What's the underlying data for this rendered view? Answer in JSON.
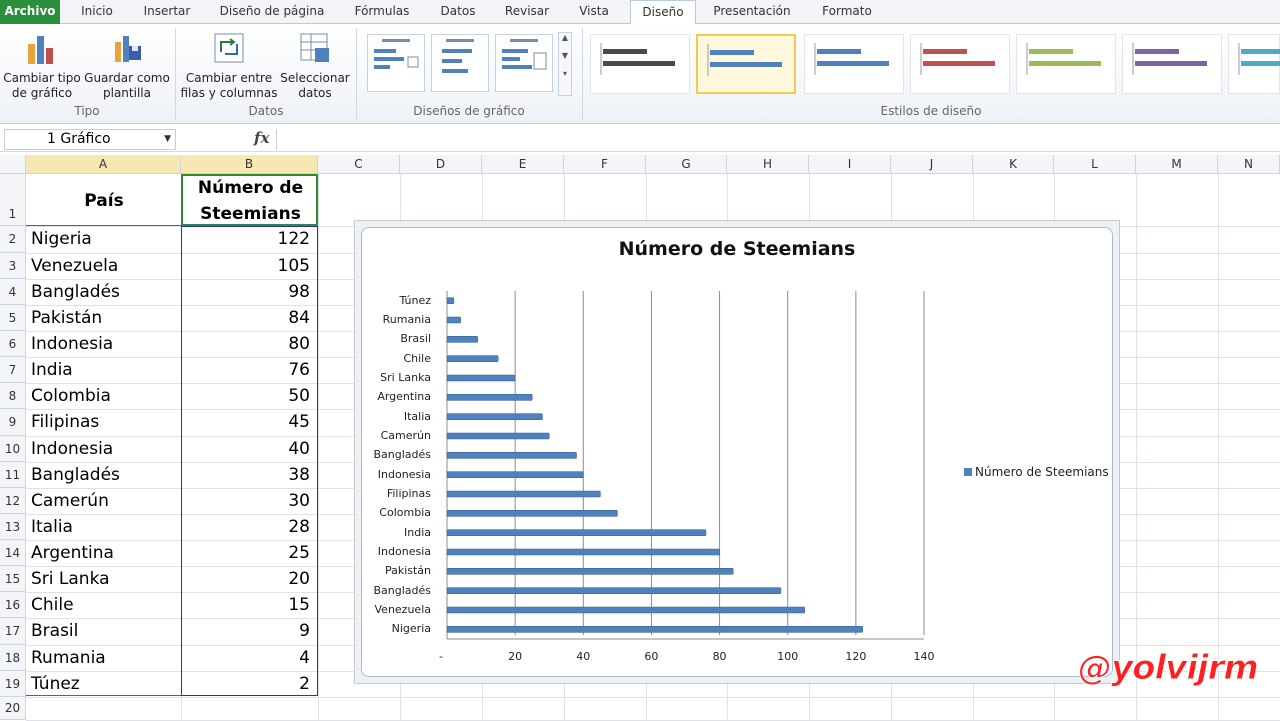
{
  "tabs": [
    {
      "label": "Archivo"
    },
    {
      "label": "Inicio"
    },
    {
      "label": "Insertar"
    },
    {
      "label": "Diseño de página"
    },
    {
      "label": "Fórmulas"
    },
    {
      "label": "Datos"
    },
    {
      "label": "Revisar"
    },
    {
      "label": "Vista"
    },
    {
      "label": "Diseño"
    },
    {
      "label": "Presentación"
    },
    {
      "label": "Formato"
    }
  ],
  "ribbon": {
    "cambiar_tipo": "Cambiar tipo de gráfico",
    "guardar_plantilla": "Guardar como plantilla",
    "cambiar_filas": "Cambiar entre filas y columnas",
    "seleccionar_datos": "Seleccionar datos",
    "group_tipo": "Tipo",
    "group_datos": "Datos",
    "group_disenos": "Diseños de gráfico",
    "group_estilos": "Estilos de diseño",
    "style_colors": [
      "#4a4a4a",
      "#4f81bd",
      "#4f81bd",
      "#c0504d",
      "#9bbb59",
      "#8064a2",
      "#4bacc6"
    ]
  },
  "namebox": {
    "value": "1 Gráfico"
  },
  "formula_icon": "fx",
  "columns": [
    "A",
    "B",
    "C",
    "D",
    "E",
    "F",
    "G",
    "H",
    "I",
    "J",
    "K",
    "L",
    "M",
    "N"
  ],
  "rows": [
    "1",
    "2",
    "3",
    "4",
    "5",
    "6",
    "7",
    "8",
    "9",
    "10",
    "11",
    "12",
    "13",
    "14",
    "15",
    "16",
    "17",
    "18",
    "19",
    "20"
  ],
  "table": {
    "header_pais": "País",
    "header_num_1": "Número de",
    "header_num_2": "Steemians",
    "rows": [
      {
        "pais": "Nigeria",
        "n": "122"
      },
      {
        "pais": "Venezuela",
        "n": "105"
      },
      {
        "pais": "Bangladés",
        "n": "98"
      },
      {
        "pais": "Pakistán",
        "n": "84"
      },
      {
        "pais": "Indonesia",
        "n": "80"
      },
      {
        "pais": "India",
        "n": "76"
      },
      {
        "pais": "Colombia",
        "n": "50"
      },
      {
        "pais": "Filipinas",
        "n": "45"
      },
      {
        "pais": "Indonesia",
        "n": "40"
      },
      {
        "pais": "Bangladés",
        "n": "38"
      },
      {
        "pais": "Camerún",
        "n": "30"
      },
      {
        "pais": "Italia",
        "n": "28"
      },
      {
        "pais": "Argentina",
        "n": "25"
      },
      {
        "pais": "Sri Lanka",
        "n": "20"
      },
      {
        "pais": "Chile",
        "n": "15"
      },
      {
        "pais": "Brasil",
        "n": "9"
      },
      {
        "pais": "Rumania",
        "n": "4"
      },
      {
        "pais": "Túnez",
        "n": "2"
      }
    ]
  },
  "chart_data": {
    "type": "bar",
    "orientation": "horizontal",
    "title": "Número de Steemians",
    "categories": [
      "Nigeria",
      "Venezuela",
      "Bangladés",
      "Pakistán",
      "Indonesia",
      "India",
      "Colombia",
      "Filipinas",
      "Indonesia",
      "Bangladés",
      "Camerún",
      "Italia",
      "Argentina",
      "Sri Lanka",
      "Chile",
      "Brasil",
      "Rumania",
      "Túnez"
    ],
    "series": [
      {
        "name": "Número de Steemians",
        "values": [
          122,
          105,
          98,
          84,
          80,
          76,
          50,
          45,
          40,
          38,
          30,
          28,
          25,
          20,
          15,
          9,
          4,
          2
        ],
        "color": "#4f81bd"
      }
    ],
    "xlim": [
      0,
      140
    ],
    "xticks": [
      "-",
      "20",
      "40",
      "60",
      "80",
      "100",
      "120",
      "140"
    ],
    "grid": true,
    "legend": "right"
  },
  "watermark": "@yolvijrm"
}
